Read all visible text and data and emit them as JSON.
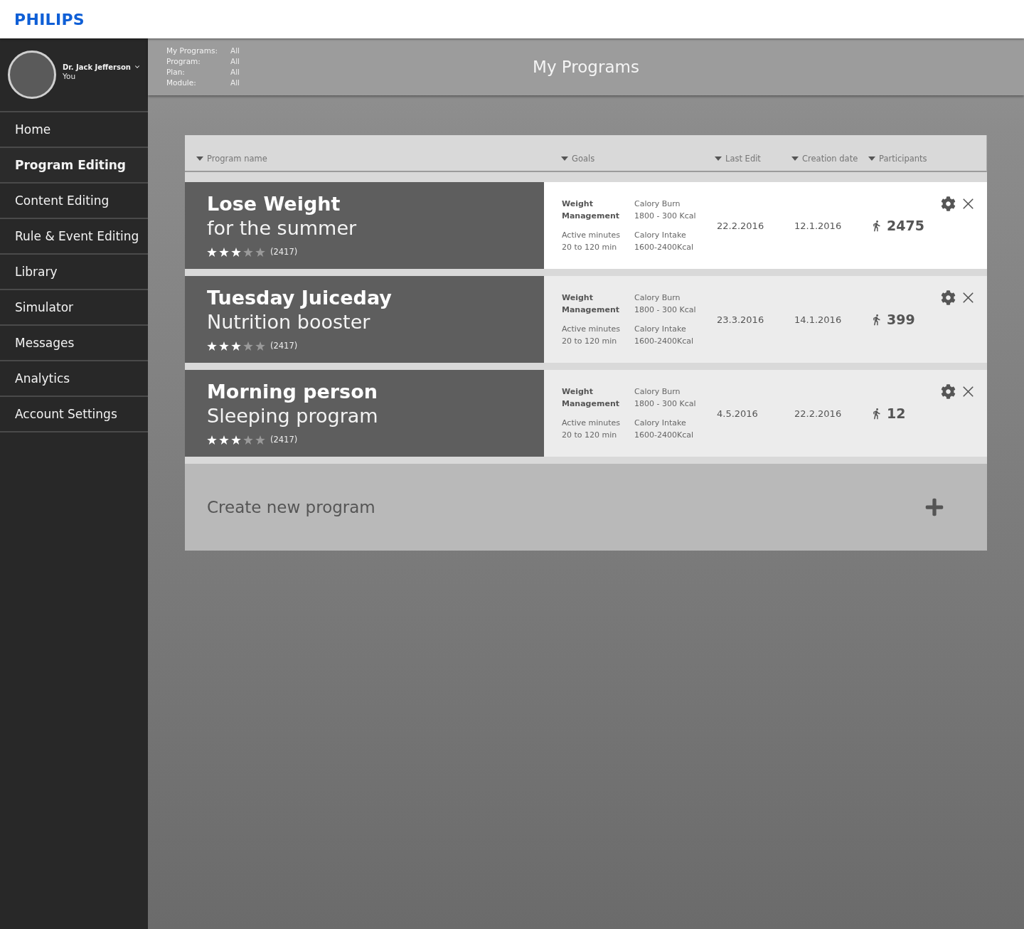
{
  "header": {
    "logo": "PHILIPS"
  },
  "sidebar": {
    "user": {
      "name": "Dr. Jack Jefferson",
      "role": "You"
    },
    "items": [
      {
        "label": "Home",
        "selected": false
      },
      {
        "label": "Program Editing",
        "selected": true
      },
      {
        "label": "Content Editing",
        "selected": false
      },
      {
        "label": "Rule & Event Editing",
        "selected": false
      },
      {
        "label": "Library",
        "selected": false
      },
      {
        "label": "Simulator",
        "selected": false
      },
      {
        "label": "Messages",
        "selected": false
      },
      {
        "label": "Analytics",
        "selected": false
      },
      {
        "label": "Account Settings",
        "selected": false
      }
    ]
  },
  "top_bar": {
    "filters": [
      {
        "label": "My Programs:",
        "value": "All"
      },
      {
        "label": "Program:",
        "value": "All"
      },
      {
        "label": "Plan:",
        "value": "All"
      },
      {
        "label": "Module:",
        "value": "All"
      }
    ],
    "title": "My Programs"
  },
  "table": {
    "columns": [
      "Program name",
      "Goals",
      "Last Edit",
      "Creation date",
      "Participants"
    ],
    "rows": [
      {
        "title": "Lose Weight",
        "subtitle": "for the summer",
        "stars": 3,
        "rating_count": "(2417)",
        "goal_category": "Weight Management",
        "goals": [
          {
            "name": "Calory Burn",
            "value": "1800 - 300 Kcal"
          },
          {
            "name": "Active minutes",
            "value": "20 to 120 min"
          },
          {
            "name": "Calory Intake",
            "value": "1600-2400Kcal"
          }
        ],
        "last_edit": "22.2.2016",
        "creation_date": "12.1.2016",
        "participants": "2475",
        "selected": true
      },
      {
        "title": "Tuesday Juiceday",
        "subtitle": "Nutrition booster",
        "stars": 3,
        "rating_count": "(2417)",
        "goal_category": "Weight Management",
        "goals": [
          {
            "name": "Calory Burn",
            "value": "1800 - 300 Kcal"
          },
          {
            "name": "Active minutes",
            "value": "20 to 120 min"
          },
          {
            "name": "Calory Intake",
            "value": "1600-2400Kcal"
          }
        ],
        "last_edit": "23.3.2016",
        "creation_date": "14.1.2016",
        "participants": "399",
        "selected": false
      },
      {
        "title": "Morning person",
        "subtitle": "Sleeping program",
        "stars": 3,
        "rating_count": "(2417)",
        "goal_category": "Weight Management",
        "goals": [
          {
            "name": "Calory Burn",
            "value": "1800 - 300 Kcal"
          },
          {
            "name": "Active minutes",
            "value": "20 to 120 min"
          },
          {
            "name": "Calory Intake",
            "value": "1600-2400Kcal"
          }
        ],
        "last_edit": "4.5.2016",
        "creation_date": "22.2.2016",
        "participants": "12",
        "selected": false
      }
    ],
    "create_button": {
      "label": "Create new program"
    }
  }
}
